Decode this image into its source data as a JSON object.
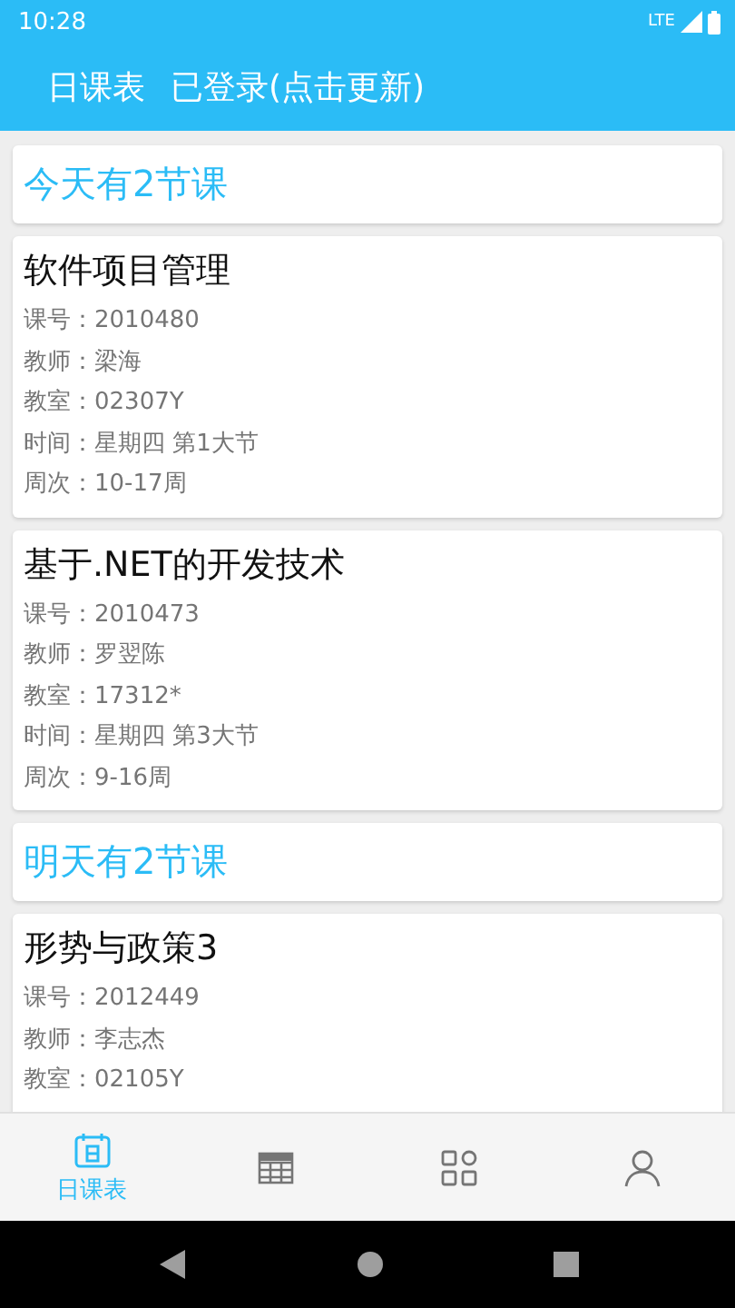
{
  "status_bar": {
    "time": "10:28",
    "network": "LTE"
  },
  "app_bar": {
    "title": "日课表",
    "subtitle": "已登录(点击更新)"
  },
  "days": [
    {
      "heading": "今天有2节课",
      "courses": [
        {
          "name": "软件项目管理",
          "lines": [
            "课号：2010480",
            "教师：梁海",
            "教室：02307Y",
            "时间：星期四 第1大节",
            "周次：10-17周"
          ]
        },
        {
          "name": "基于.NET的开发技术",
          "lines": [
            "课号：2010473",
            "教师：罗翌陈",
            "教室：17312*",
            "时间：星期四 第3大节",
            "周次：9-16周"
          ]
        }
      ]
    },
    {
      "heading": "明天有2节课",
      "courses": [
        {
          "name": "形势与政策3",
          "lines": [
            "课号：2012449",
            "教师：李志杰",
            "教室：02105Y"
          ]
        }
      ]
    }
  ],
  "bottom_nav": [
    {
      "kind": "day",
      "label": "日课表",
      "selected": true
    },
    {
      "kind": "week",
      "selected": false
    },
    {
      "kind": "grid",
      "selected": false
    },
    {
      "kind": "person",
      "selected": false
    }
  ]
}
